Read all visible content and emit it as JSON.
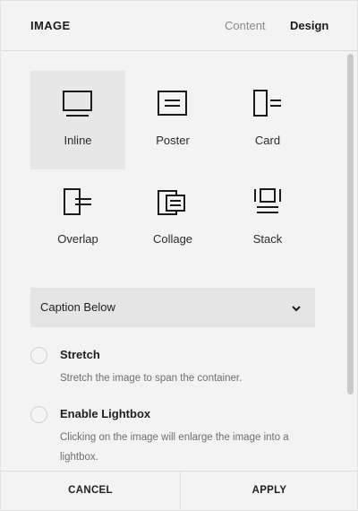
{
  "header": {
    "title": "IMAGE",
    "tabs": [
      {
        "label": "Content",
        "active": false
      },
      {
        "label": "Design",
        "active": true
      }
    ]
  },
  "layouts": [
    {
      "label": "Inline",
      "icon": "inline-layout-icon",
      "selected": true
    },
    {
      "label": "Poster",
      "icon": "poster-layout-icon",
      "selected": false
    },
    {
      "label": "Card",
      "icon": "card-layout-icon",
      "selected": false
    },
    {
      "label": "Overlap",
      "icon": "overlap-layout-icon",
      "selected": false
    },
    {
      "label": "Collage",
      "icon": "collage-layout-icon",
      "selected": false
    },
    {
      "label": "Stack",
      "icon": "stack-layout-icon",
      "selected": false
    }
  ],
  "caption_select": {
    "value": "Caption Below"
  },
  "options": [
    {
      "title": "Stretch",
      "description": "Stretch the image to span the container.",
      "checked": false
    },
    {
      "title": "Enable Lightbox",
      "description": "Clicking on the image will enlarge the image into a lightbox.",
      "checked": false
    }
  ],
  "footer": {
    "cancel_label": "CANCEL",
    "apply_label": "APPLY"
  },
  "colors": {
    "background": "#f3f3f3",
    "selected_tile": "#e7e7e7",
    "select_bg": "#e5e5e5"
  }
}
